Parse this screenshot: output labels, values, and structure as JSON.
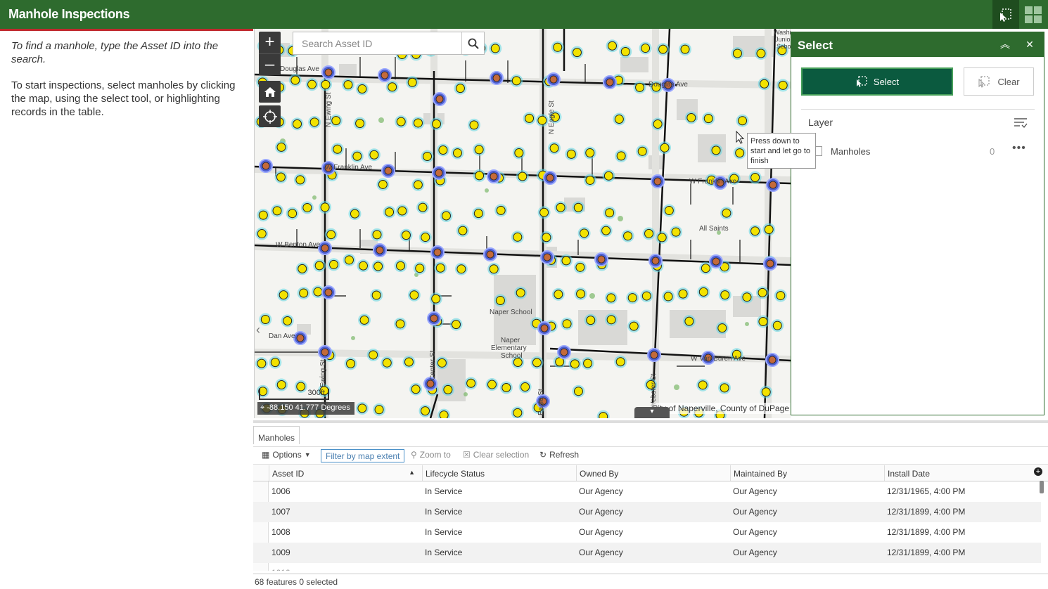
{
  "header": {
    "title": "Manhole Inspections"
  },
  "left_panel": {
    "instructions_1": "To find a manhole, type the Asset ID into the search.",
    "instructions_2": "To start inspections, select manholes by clicking the map, using the select tool, or highlighting records in the table."
  },
  "map": {
    "search_placeholder": "Search Asset ID",
    "scale_label": "300ft",
    "coordinates": "-88.150 41.777 Degrees",
    "attribution": "City of Naperville, County of DuPage",
    "labels": [
      "Washington Junior High School",
      "Douglas Ave",
      "W Franklin Ave",
      "N Eagle St",
      "W Franklin Ave",
      "W Benton Ave",
      "All Saints",
      "Naper School",
      "Naper Elementary School",
      "W Van Buren Ave",
      "Ewing St",
      "Webster St",
      "Center St"
    ]
  },
  "select_panel": {
    "title": "Select",
    "select_label": "Select",
    "clear_label": "Clear",
    "layer_label": "Layer",
    "layer_name": "Manholes",
    "layer_count": "0",
    "tooltip": "Press down to start and let go to finish"
  },
  "table": {
    "tab": "Manholes",
    "toolbar": {
      "options": "Options",
      "filter": "Filter by map extent",
      "zoom": "Zoom to",
      "clear": "Clear selection",
      "refresh": "Refresh"
    },
    "columns": [
      "Asset ID",
      "Lifecycle Status",
      "Owned By",
      "Maintained By",
      "Install Date"
    ],
    "rows": [
      [
        "1006",
        "In Service",
        "Our Agency",
        "Our Agency",
        "12/31/1965, 4:00 PM"
      ],
      [
        "1007",
        "In Service",
        "Our Agency",
        "Our Agency",
        "12/31/1899, 4:00 PM"
      ],
      [
        "1008",
        "In Service",
        "Our Agency",
        "Our Agency",
        "12/31/1899, 4:00 PM"
      ],
      [
        "1009",
        "In Service",
        "Our Agency",
        "Our Agency",
        "12/31/1899, 4:00 PM"
      ]
    ],
    "footer": "68 features 0 selected"
  },
  "colors": {
    "header": "#2e6b2e",
    "accent_red": "#c0282d",
    "select_button": "#0b5a3f"
  }
}
